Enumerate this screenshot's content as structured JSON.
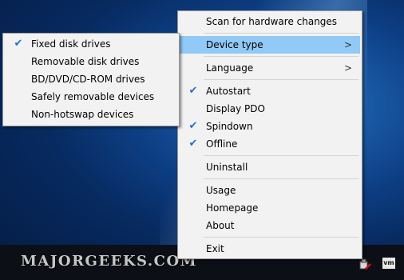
{
  "watermark": "MAJORGEEKS.COM",
  "tray": {
    "vm_label": "vm"
  },
  "colors": {
    "highlight": "#91c9f7",
    "menu_bg": "#f2f2f2",
    "check": "#1e6fd0"
  },
  "main_menu": {
    "scan": "Scan for hardware changes",
    "device_type": "Device type",
    "language": "Language",
    "autostart": "Autostart",
    "display_pdo": "Display PDO",
    "spindown": "Spindown",
    "offline": "Offline",
    "uninstall": "Uninstall",
    "usage": "Usage",
    "homepage": "Homepage",
    "about": "About",
    "exit": "Exit",
    "arrow": ">",
    "check": "✔"
  },
  "submenu": {
    "fixed": "Fixed disk drives",
    "removable": "Removable disk drives",
    "optical": "BD/DVD/CD-ROM drives",
    "safely": "Safely removable devices",
    "nonhotswap": "Non-hotswap devices"
  }
}
